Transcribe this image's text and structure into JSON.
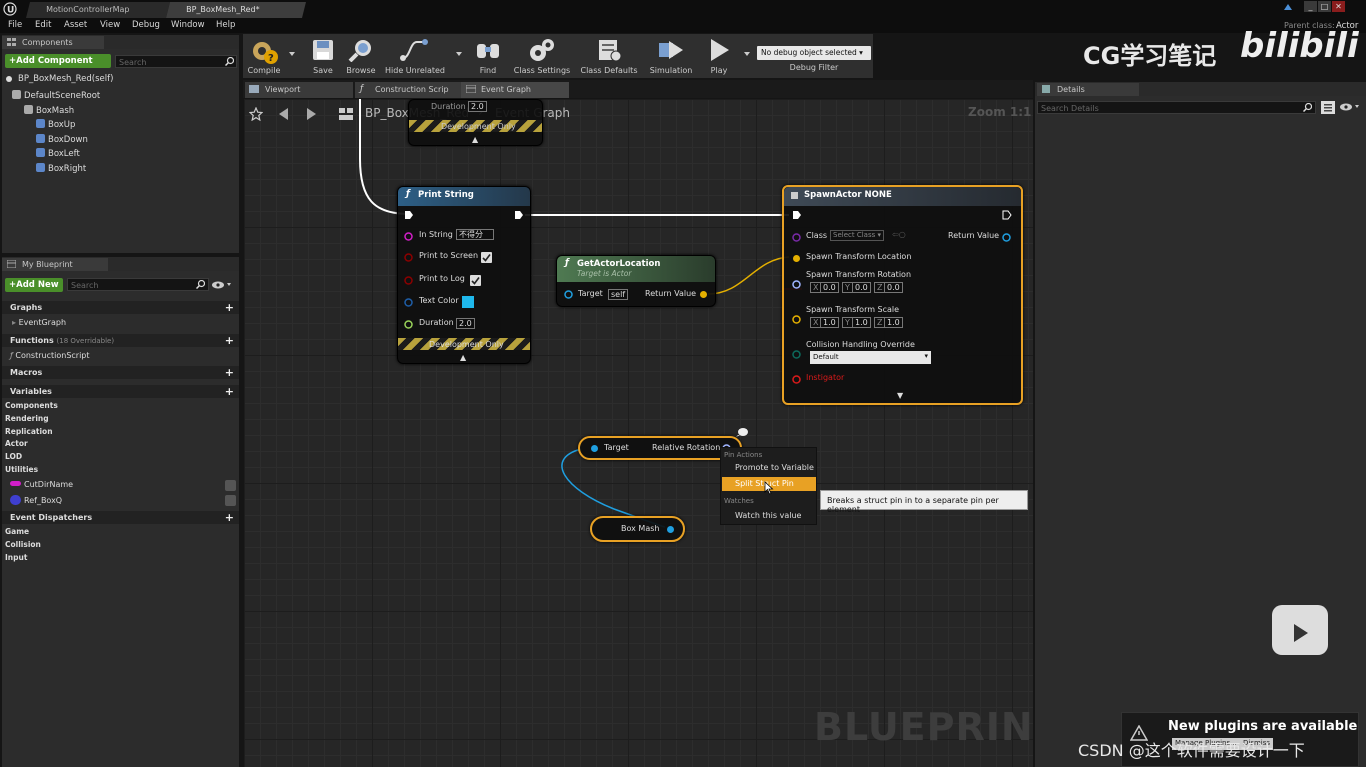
{
  "window": {
    "tabs": [
      "MotionControllerMap",
      "BP_BoxMesh_Red*"
    ],
    "parent_class_label": "Parent class:",
    "parent_class_value": "Actor",
    "controls": [
      "_",
      "□",
      "✕"
    ]
  },
  "menu": [
    "File",
    "Edit",
    "Asset",
    "View",
    "Debug",
    "Window",
    "Help"
  ],
  "components": {
    "tab": "Components",
    "add_button": "+Add Component",
    "search_placeholder": "Search",
    "self_item": "BP_BoxMesh_Red(self)",
    "tree": [
      {
        "label": "DefaultSceneRoot",
        "depth": 0
      },
      {
        "label": "BoxMash",
        "depth": 1
      },
      {
        "label": "BoxUp",
        "depth": 2
      },
      {
        "label": "BoxDown",
        "depth": 2
      },
      {
        "label": "BoxLeft",
        "depth": 2
      },
      {
        "label": "BoxRight",
        "depth": 2
      }
    ]
  },
  "my_blueprint": {
    "tab": "My Blueprint",
    "add_new": "+Add New",
    "search_placeholder": "Search",
    "graphs_label": "Graphs",
    "event_graph": "EventGraph",
    "functions_label": "Functions",
    "functions_note": "(18 Overridable)",
    "construction_script": "ConstructionScript",
    "macros_label": "Macros",
    "variables_label": "Variables",
    "variable_categories": [
      "Components",
      "Rendering",
      "Replication",
      "Actor",
      "LOD",
      "Utilities"
    ],
    "variables": [
      {
        "name": "CutDirName",
        "color": "#d21ec8"
      },
      {
        "name": "Ref_BoxQ",
        "color": "#3f3fd0"
      }
    ],
    "dispatchers_label": "Event Dispatchers",
    "dispatcher_categories": [
      "Game",
      "Collision",
      "Input"
    ]
  },
  "toolbar": {
    "buttons": [
      "Compile",
      "Save",
      "Browse",
      "Hide Unrelated",
      "Find",
      "Class Settings",
      "Class Defaults",
      "Simulation",
      "Play"
    ],
    "debug_dropdown": "No debug object selected",
    "debug_filter": "Debug Filter"
  },
  "editor_tabs": [
    "Viewport",
    "Construction Scrip",
    "Event Graph"
  ],
  "breadcrumb": {
    "root": "BP_BoxMesh_Red",
    "current": "Event Graph",
    "zoom": "Zoom 1:1"
  },
  "nodes": {
    "top_partial": {
      "duration_label": "Duration",
      "duration_value": "2.0",
      "dev_only": "Development Only"
    },
    "print_string": {
      "title": "Print String",
      "in_string_label": "In String",
      "in_string_value": "不得分",
      "print_to_screen": "Print to Screen",
      "print_to_log": "Print to Log",
      "text_color": "Text Color",
      "text_color_value": "#1fb8ec",
      "duration_label": "Duration",
      "duration_value": "2.0",
      "dev_only": "Development Only"
    },
    "get_actor_location": {
      "title": "GetActorLocation",
      "subtitle": "Target is Actor",
      "target_label": "Target",
      "target_value": "self",
      "return_label": "Return Value"
    },
    "spawn_actor": {
      "title": "SpawnActor NONE",
      "class_label": "Class",
      "class_value": "Select Class",
      "return_label": "Return Value",
      "location_label": "Spawn Transform Location",
      "rotation_label": "Spawn Transform Rotation",
      "rotation": {
        "x_label": "X",
        "x": "0.0",
        "y_label": "Y",
        "y": "0.0",
        "z_label": "Z",
        "z": "0.0"
      },
      "scale_label": "Spawn Transform Scale",
      "scale": {
        "x_label": "X",
        "x": "1.0",
        "y_label": "Y",
        "y": "1.0",
        "z_label": "Z",
        "z": "1.0"
      },
      "collision_label": "Collision Handling Override",
      "collision_value": "Default",
      "instigator_label": "Instigator"
    },
    "relative_rotation": {
      "target_label": "Target",
      "output_label": "Relative Rotation"
    },
    "box_mash": {
      "label": "Box Mash"
    }
  },
  "context_menu": {
    "section1": "Pin Actions",
    "items": [
      "Promote to Variable",
      "Split Struct Pin"
    ],
    "section2": "Watches",
    "watch": "Watch this value"
  },
  "tooltip": "Breaks a struct pin in to a separate pin per element",
  "watermark": "BLUEPRINT",
  "details": {
    "tab": "Details",
    "search_placeholder": "Search Details"
  },
  "notification": {
    "title": "New plugins are available",
    "button1": "Manage Plugins...",
    "button2": "Dismiss"
  },
  "overlay": {
    "top_right": "CG学习笔记",
    "logo": "bilibili",
    "bottom_right": "CSDN @这个软件需要设计一下"
  }
}
